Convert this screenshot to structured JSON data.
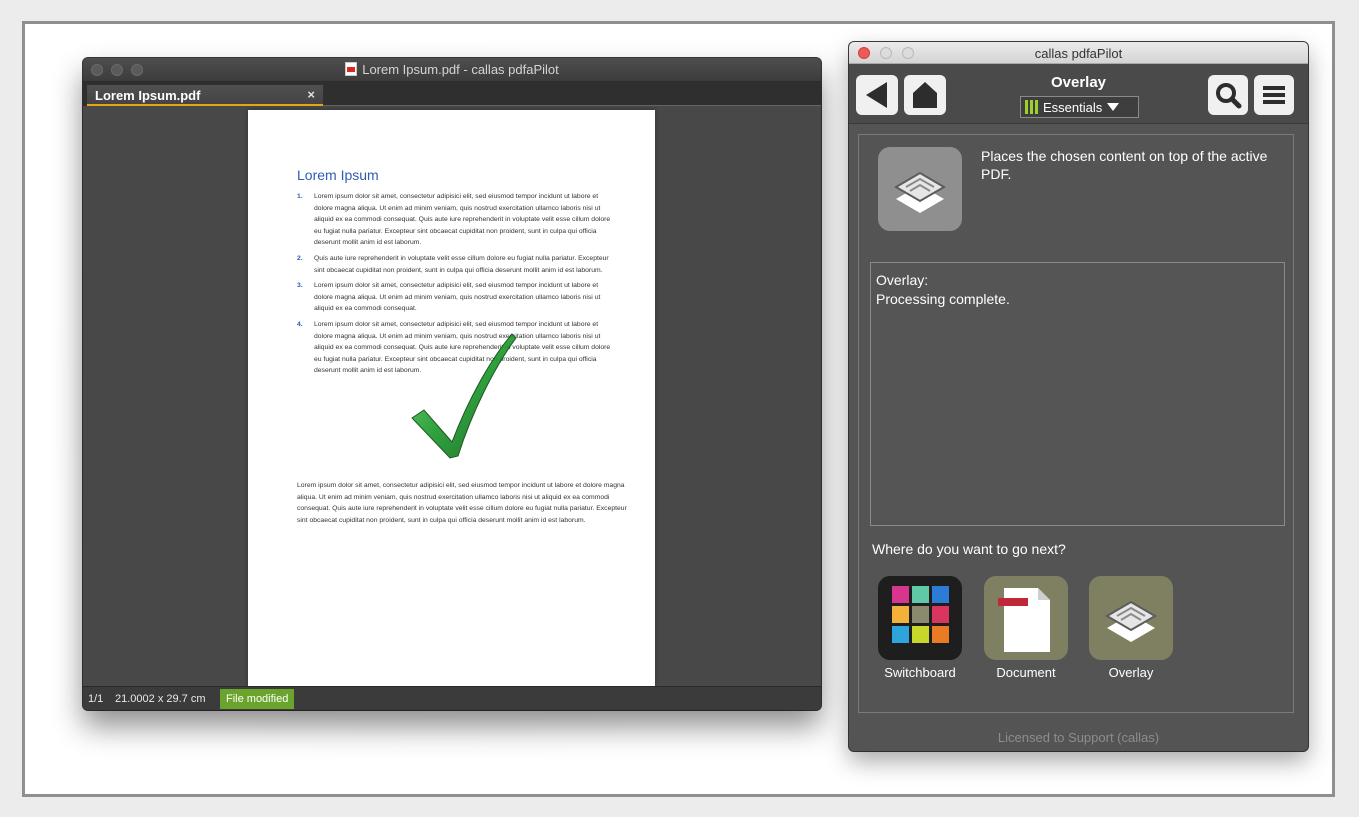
{
  "pdf_window": {
    "title": "Lorem Ipsum.pdf - callas pdfaPilot",
    "tab": {
      "label": "Lorem Ipsum.pdf",
      "close": "×"
    },
    "document": {
      "heading": "Lorem Ipsum",
      "list": [
        {
          "num": "1.",
          "text": "Lorem ipsum dolor sit amet, consectetur adipisici elit, sed eiusmod tempor incidunt ut labore et dolore magna aliqua. Ut enim ad minim veniam, quis nostrud exercitation ullamco laboris nisi ut aliquid ex ea commodi consequat. Quis aute iure reprehenderit in voluptate velit esse cillum dolore eu fugiat nulla pariatur. Excepteur sint obcaecat cupiditat non proident, sunt in culpa qui officia deserunt mollit anim id est laborum."
        },
        {
          "num": "2.",
          "text": "Quis aute iure reprehenderit in voluptate velit esse cillum dolore eu fugiat nulla pariatur. Excepteur sint obcaecat cupiditat non proident, sunt in culpa qui officia deserunt mollit anim id est laborum."
        },
        {
          "num": "3.",
          "text": "Lorem ipsum dolor sit amet, consectetur adipisici elit, sed eiusmod tempor incidunt ut labore et dolore magna aliqua. Ut enim ad minim veniam, quis nostrud exercitation ullamco laboris nisi ut aliquid ex ea commodi consequat."
        },
        {
          "num": "4.",
          "text": "Lorem ipsum dolor sit amet, consectetur adipisici elit, sed eiusmod tempor incidunt ut labore et dolore magna aliqua. Ut enim ad minim veniam, quis nostrud exercitation ullamco laboris nisi ut aliquid ex ea commodi consequat. Quis aute iure reprehenderit in voluptate velit esse cillum dolore eu fugiat nulla pariatur. Excepteur sint obcaecat cupiditat non proident, sunt in culpa qui officia deserunt mollit anim id est laborum."
        }
      ],
      "paragraph": "Lorem ipsum dolor sit amet, consectetur adipisici elit, sed eiusmod tempor incidunt ut labore et dolore magna aliqua. Ut enim ad minim veniam, quis nostrud exercitation ullamco laboris nisi ut aliquid ex ea commodi consequat. Quis aute iure reprehenderit in voluptate velit esse cillum dolore eu fugiat nulla pariatur. Excepteur sint obcaecat cupiditat non proident, sunt in culpa qui officia deserunt mollit anim id est laborum."
    },
    "status": {
      "page": "1/1",
      "size": "21.0002 x 29.7 cm",
      "state": "File modified"
    }
  },
  "pilot_window": {
    "title": "callas pdfaPilot",
    "toolbar": {
      "title": "Overlay",
      "profile": "Essentials"
    },
    "operation": {
      "description": "Places the chosen content on top of the active PDF."
    },
    "result": {
      "line1": "Overlay:",
      "line2": "Processing complete."
    },
    "next": {
      "label": "Where do you want to go next?",
      "items": [
        {
          "label": "Switchboard"
        },
        {
          "label": "Document"
        },
        {
          "label": "Overlay"
        }
      ]
    },
    "license": "Licensed to Support (callas)"
  },
  "colors": {
    "accent_green": "#6aa42c",
    "tab_underline": "#e6a417",
    "doc_blue": "#2e5cb6"
  }
}
